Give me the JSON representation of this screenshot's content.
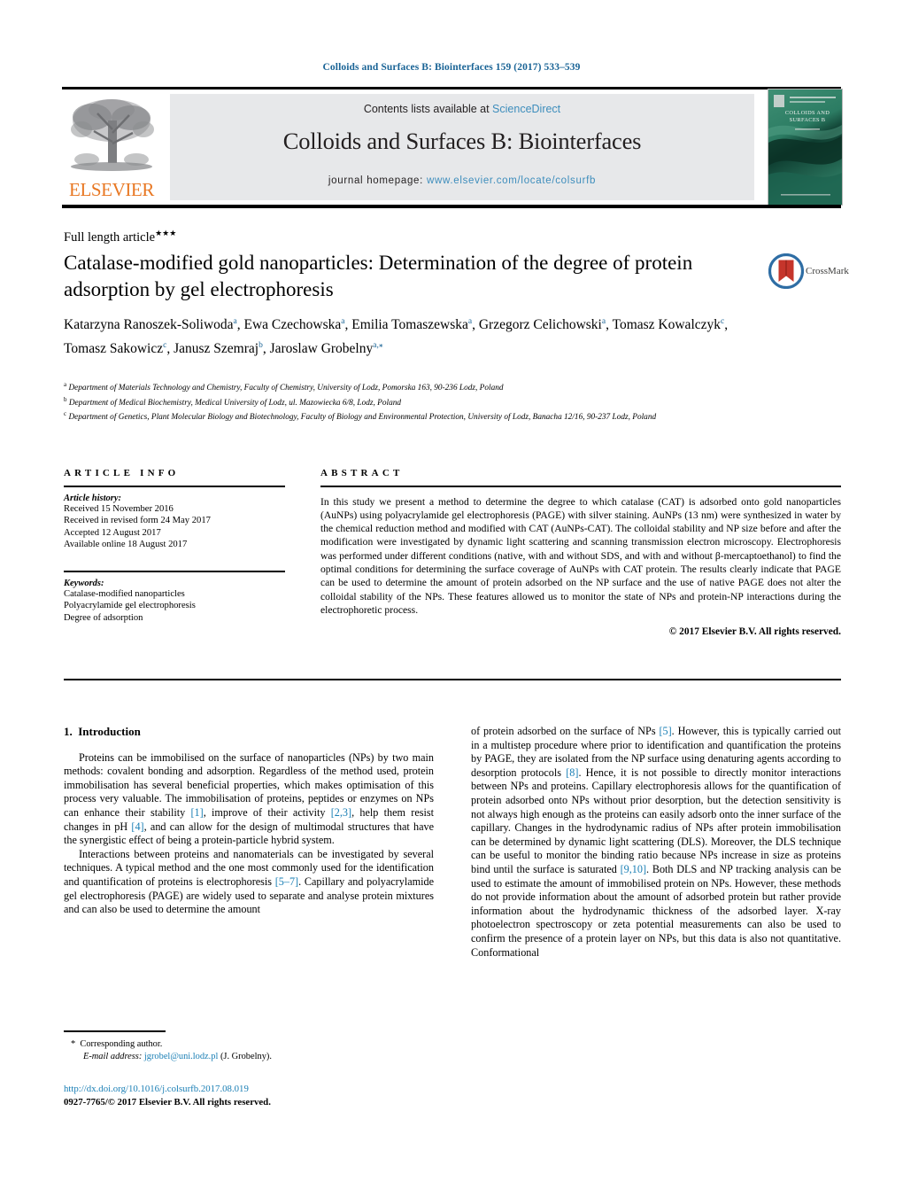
{
  "running_head": "Colloids and Surfaces B: Biointerfaces 159 (2017) 533–539",
  "masthead": {
    "contents_prefix": "Contents lists available at ",
    "sciencedirect": "ScienceDirect",
    "journal_name": "Colloids and Surfaces B: Biointerfaces",
    "homepage_prefix": "journal homepage: ",
    "homepage_url": "www.elsevier.com/locate/colsurfb",
    "publisher_wordmark": "ELSEVIER",
    "cover_title_line1": "COLLOIDS AND",
    "cover_title_line2": "SURFACES B",
    "colors": {
      "link_blue": "#3d8dbc",
      "elsevier_orange": "#E87722",
      "band_gray": "#e7e8ea",
      "cover_green": "#1f6b57"
    }
  },
  "article": {
    "type": "Full length article",
    "type_marker": "★★★",
    "title": "Catalase-modified gold nanoparticles: Determination of the degree of protein adsorption by gel electrophoresis",
    "crossmark_label": "CrossMark",
    "authors_html": "Katarzyna Ranoszek-Soliwoda<sup>a</sup>, Ewa Czechowska<sup>a</sup>, Emilia Tomaszewska<sup>a</sup>, Grzegorz Celichowski<sup>a</sup>, Tomasz Kowalczyk<sup>c</sup>, Tomasz Sakowicz<sup>c</sup>, Janusz Szemraj<sup>b</sup>, Jaroslaw Grobelny<sup>a,⁎</sup>",
    "affiliations": [
      {
        "marker": "a",
        "text": "Department of Materials Technology and Chemistry, Faculty of Chemistry, University of Lodz, Pomorska 163, 90-236 Lodz, Poland"
      },
      {
        "marker": "b",
        "text": "Department of Medical Biochemistry, Medical University of Lodz, ul. Mazowiecka 6/8, Lodz, Poland"
      },
      {
        "marker": "c",
        "text": "Department of Genetics, Plant Molecular Biology and Biotechnology, Faculty of Biology and Environmental Protection, University of Lodz, Banacha 12/16, 90-237 Lodz, Poland"
      }
    ]
  },
  "article_info": {
    "heading": "ARTICLE INFO",
    "history_label": "Article history:",
    "history": [
      "Received 15 November 2016",
      "Received in revised form 24 May 2017",
      "Accepted 12 August 2017",
      "Available online 18 August 2017"
    ],
    "keywords_label": "Keywords:",
    "keywords": [
      "Catalase-modified nanoparticles",
      "Polyacrylamide gel electrophoresis",
      "Degree of adsorption"
    ]
  },
  "abstract": {
    "heading": "ABSTRACT",
    "text": "In this study we present a method to determine the degree to which catalase (CAT) is adsorbed onto gold nanoparticles (AuNPs) using polyacrylamide gel electrophoresis (PAGE) with silver staining. AuNPs (13 nm) were synthesized in water by the chemical reduction method and modified with CAT (AuNPs-CAT). The colloidal stability and NP size before and after the modification were investigated by dynamic light scattering and scanning transmission electron microscopy. Electrophoresis was performed under different conditions (native, with and without SDS, and with and without β-mercaptoethanol) to find the optimal conditions for determining the surface coverage of AuNPs with CAT protein. The results clearly indicate that PAGE can be used to determine the amount of protein adsorbed on the NP surface and the use of native PAGE does not alter the colloidal stability of the NPs. These features allowed us to monitor the state of NPs and protein-NP interactions during the electrophoretic process.",
    "copyright": "© 2017 Elsevier B.V. All rights reserved."
  },
  "body": {
    "section_number": "1.",
    "section_title": "Introduction",
    "left_paragraph_1_a": "Proteins can be immobilised on the surface of nanoparticles (NPs) by two main methods: covalent bonding and adsorption. Regardless of the method used, protein immobilisation has several beneficial properties, which makes optimisation of this process very valuable. The immobilisation of proteins, peptides or enzymes on NPs can enhance their stability ",
    "ref_1": "[1]",
    "left_paragraph_1_b": ", improve of their activity ",
    "ref_2_3": "[2,3]",
    "left_paragraph_1_c": ", help them resist changes in pH ",
    "ref_4": "[4]",
    "left_paragraph_1_d": ", and can allow for the design of multimodal structures that have the synergistic effect of being a protein-particle hybrid system.",
    "left_paragraph_2_a": "Interactions between proteins and nanomaterials can be investigated by several techniques. A typical method and the one most commonly used for the identification and quantification of proteins is electrophoresis ",
    "ref_5_7": "[5–7]",
    "left_paragraph_2_b": ". Capillary and polyacrylamide gel electrophoresis (PAGE) are widely used to separate and analyse protein mixtures and can also be used to determine the amount",
    "right_paragraph_a": "of protein adsorbed on the surface of NPs ",
    "ref_5": "[5]",
    "right_paragraph_b": ". However, this is typically carried out in a multistep procedure where prior to identification and quantification the proteins by PAGE, they are isolated from the NP surface using denaturing agents according to desorption protocols ",
    "ref_8": "[8]",
    "right_paragraph_c": ". Hence, it is not possible to directly monitor interactions between NPs and proteins. Capillary electrophoresis allows for the quantification of protein adsorbed onto NPs without prior desorption, but the detection sensitivity is not always high enough as the proteins can easily adsorb onto the inner surface of the capillary. Changes in the hydrodynamic radius of NPs after protein immobilisation can be determined by dynamic light scattering (DLS). Moreover, the DLS technique can be useful to monitor the binding ratio because NPs increase in size as proteins bind until the surface is saturated ",
    "ref_9_10": "[9,10]",
    "right_paragraph_d": ". Both DLS and NP tracking analysis can be used to estimate the amount of immobilised protein on NPs. However, these methods do not provide information about the amount of adsorbed protein but rather provide information about the hydrodynamic thickness of the adsorbed layer. X-ray photoelectron spectroscopy or zeta potential measurements can also be used to confirm the presence of a protein layer on NPs, but this data is also not quantitative. Conformational"
  },
  "footer": {
    "corresponding_marker": "*",
    "corresponding_author": "Corresponding author.",
    "email_label": "E-mail address:",
    "email": "jgrobel@uni.lodz.pl",
    "email_owner": "(J. Grobelny).",
    "doi_url": "http://dx.doi.org/10.1016/j.colsurfb.2017.08.019",
    "issn_line": "0927-7765/© 2017 Elsevier B.V. All rights reserved."
  }
}
